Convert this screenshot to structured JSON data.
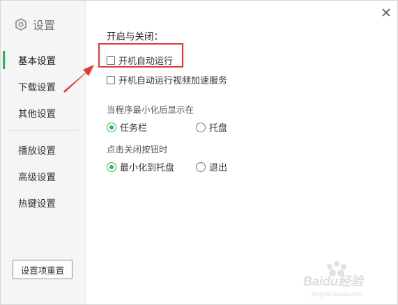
{
  "sidebar": {
    "title": "设置",
    "items": [
      {
        "label": "基本设置",
        "active": true
      },
      {
        "label": "下载设置",
        "active": false
      },
      {
        "label": "其他设置",
        "active": false
      },
      {
        "label": "播放设置",
        "active": false
      },
      {
        "label": "高级设置",
        "active": false
      },
      {
        "label": "热键设置",
        "active": false
      }
    ],
    "reset_label": "设置项重置"
  },
  "main": {
    "section_title": "开启与关闭：",
    "startup_checkbox": {
      "label": "开机自动运行",
      "checked": false
    },
    "accelerate_checkbox": {
      "label": "开机自动运行视频加速服务",
      "checked": false
    },
    "minimize_group": {
      "label": "当程序最小化后显示在",
      "options": [
        {
          "label": "任务栏",
          "checked": true
        },
        {
          "label": "托盘",
          "checked": false
        }
      ]
    },
    "close_group": {
      "label": "点击关闭按钮时",
      "options": [
        {
          "label": "最小化到托盘",
          "checked": true
        },
        {
          "label": "退出",
          "checked": false
        }
      ]
    }
  },
  "watermark": {
    "text": "Baidu经验",
    "sub": "jingyan.baidu.com"
  },
  "icons": {
    "brand": "settings-hexagon-icon",
    "close": "close-icon",
    "annotation": "red-arrow-icon"
  },
  "colors": {
    "accent": "#2db84d",
    "annotation": "#e53935",
    "sidebar_bg": "#f5f5f5"
  }
}
